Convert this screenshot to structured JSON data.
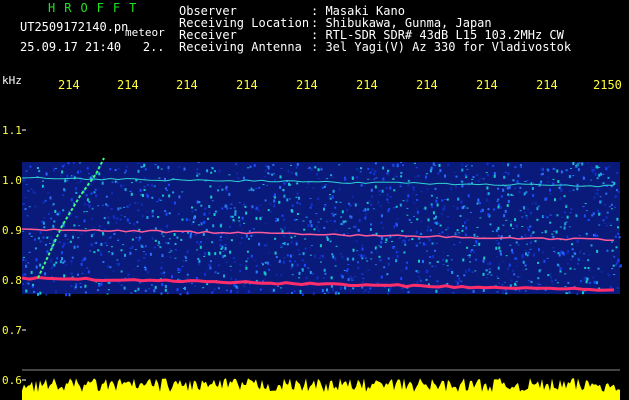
{
  "header": {
    "title": "HROFFT",
    "filename": "UT2509172140.pn",
    "mode": "meteor",
    "datetime": "25.09.17 21:40",
    "counter": "2.."
  },
  "info": [
    {
      "key": "Observer",
      "value": ": Masaki Kano"
    },
    {
      "key": "Receiving Location",
      "value": ": Shibukawa, Gunma, Japan"
    },
    {
      "key": "Receiver",
      "value": ": RTL-SDR SDR# 43dB L15 103.2MHz CW"
    },
    {
      "key": "Receiving Antenna",
      "value": ": 3el Yagi(V) Az 330 for Vladivostok"
    }
  ],
  "axis": {
    "unit": "kHz",
    "freq_labels": [
      "214",
      "214",
      "214",
      "214",
      "214",
      "214",
      "214",
      "214",
      "214",
      "2150"
    ],
    "y_labels": [
      "1.1",
      "1.0",
      "0.9",
      "0.8",
      "0.7",
      "0.6"
    ]
  },
  "colors": {
    "background": "#000000",
    "title": "#22e022",
    "label": "#ffff3a",
    "text": "#ffffff",
    "signal": "#ff2e6a",
    "noise": "#1a3cff"
  }
}
